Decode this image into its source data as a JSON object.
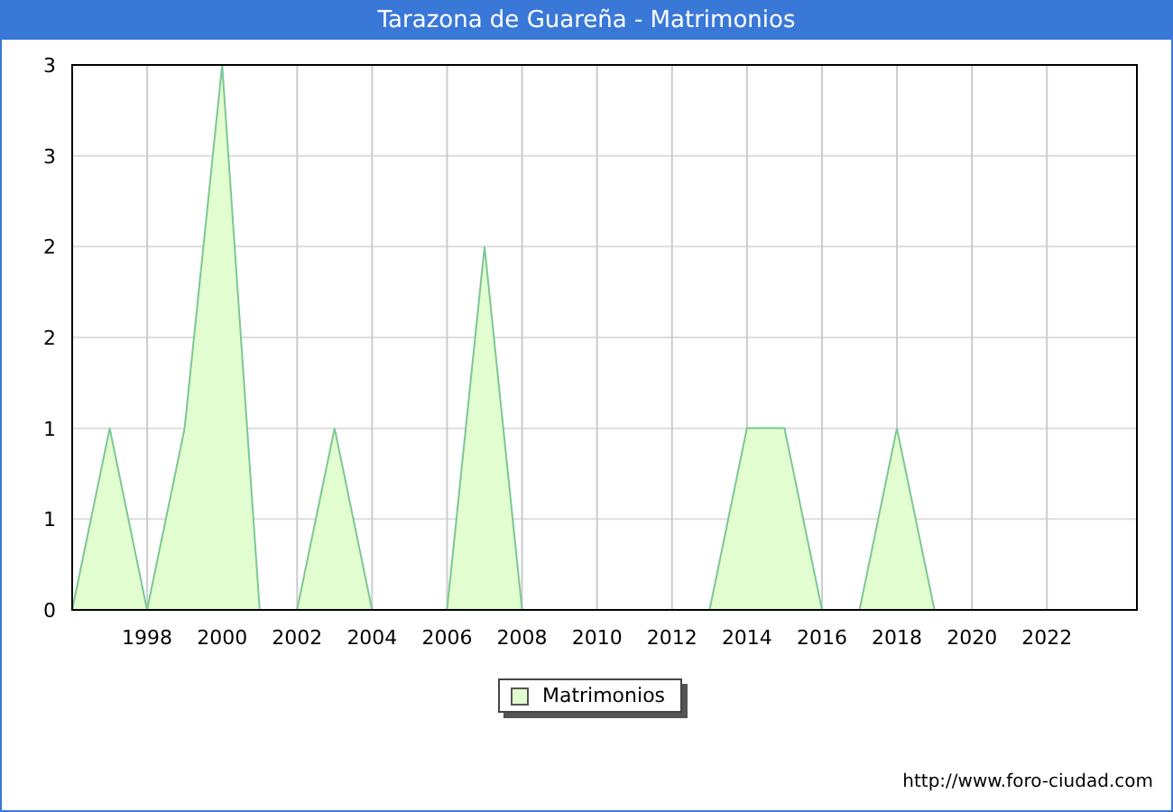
{
  "window": {
    "title": "Tarazona de Guareña - Matrimonios"
  },
  "chart": {
    "chart_data": {
      "type": "area",
      "x": [
        1996,
        1997,
        1998,
        1999,
        2000,
        2001,
        2002,
        2003,
        2004,
        2005,
        2006,
        2007,
        2008,
        2009,
        2010,
        2011,
        2012,
        2013,
        2014,
        2015,
        2016,
        2017,
        2018,
        2019
      ],
      "series": [
        {
          "name": "Matrimonios",
          "color": "#e2fdcf",
          "values": [
            0,
            1,
            0,
            1,
            3,
            0,
            0,
            1,
            0,
            null,
            0,
            2,
            0,
            null,
            null,
            null,
            null,
            0,
            1,
            1,
            0,
            0,
            1,
            0
          ]
        }
      ],
      "grid": true,
      "xlim": [
        1996,
        2024.4
      ],
      "ylim": [
        0,
        3
      ],
      "xticks": [
        1998,
        2000,
        2002,
        2004,
        2006,
        2008,
        2010,
        2012,
        2014,
        2016,
        2018,
        2020,
        2022
      ],
      "yticks": [
        {
          "value": 0,
          "label": "0"
        },
        {
          "value": 0.5,
          "label": "1"
        },
        {
          "value": 1,
          "label": "1"
        },
        {
          "value": 1.5,
          "label": "2"
        },
        {
          "value": 2,
          "label": "2"
        },
        {
          "value": 2.5,
          "label": "3"
        },
        {
          "value": 3,
          "label": "3"
        }
      ]
    }
  },
  "footer": {
    "url": "http://www.foro-ciudad.com"
  }
}
